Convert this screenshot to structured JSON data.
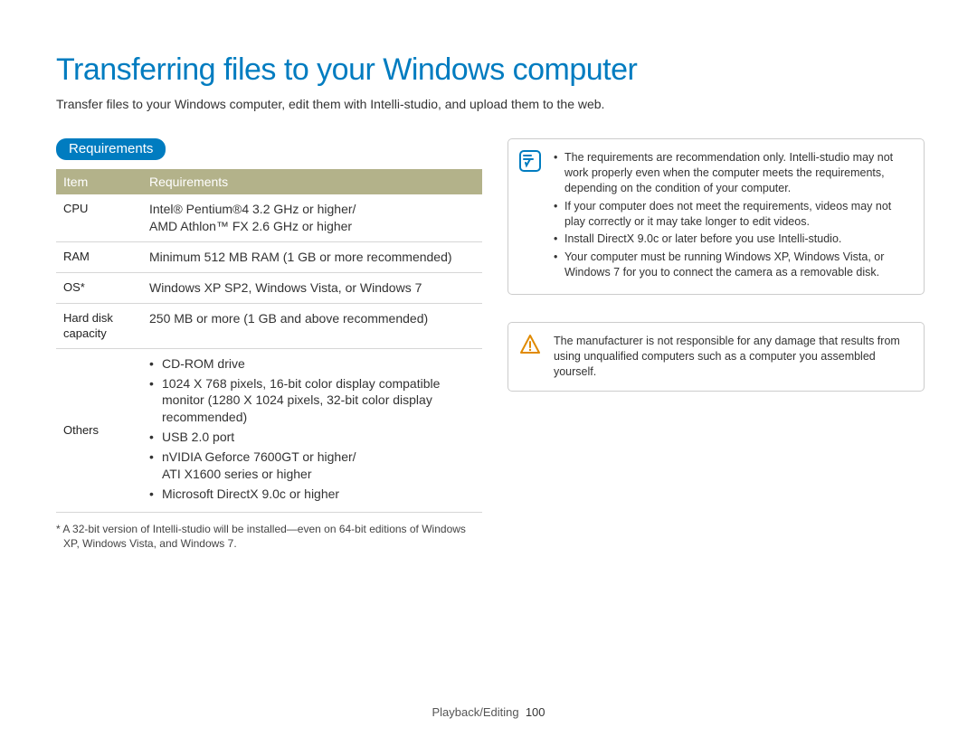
{
  "title": "Transferring files to your Windows computer",
  "intro": "Transfer files to your Windows computer, edit them with Intelli-studio, and upload them to the web.",
  "section_label": "Requirements",
  "table": {
    "head_item": "Item",
    "head_req": "Requirements",
    "rows": {
      "cpu_label": "CPU",
      "cpu_value": "Intel® Pentium®4 3.2 GHz or higher/\nAMD Athlon™ FX 2.6 GHz or higher",
      "ram_label": "RAM",
      "ram_value": "Minimum 512 MB RAM (1 GB or more recommended)",
      "os_label": "OS*",
      "os_value": "Windows XP SP2, Windows Vista, or Windows 7",
      "hdd_label": "Hard disk capacity",
      "hdd_value": "250 MB or more (1 GB and above recommended)",
      "others_label": "Others",
      "others_items": {
        "i1": "CD-ROM drive",
        "i2": "1024 X 768 pixels, 16-bit color display compatible monitor (1280 X 1024 pixels, 32-bit color display recommended)",
        "i3": "USB 2.0 port",
        "i4": "nVIDIA Geforce 7600GT or higher/\nATI X1600 series or higher",
        "i5": "Microsoft DirectX 9.0c or higher"
      }
    }
  },
  "footnote": "* A 32-bit version of Intelli-studio will be installed—even on 64-bit editions of Windows XP, Windows Vista, and Windows 7.",
  "notes": {
    "n1": "The requirements are recommendation only. Intelli-studio may not work properly even when the computer meets the requirements, depending on the condition of your computer.",
    "n2": "If your computer does not meet the requirements, videos may not play correctly or it may take longer to edit videos.",
    "n3": "Install DirectX 9.0c or later before you use Intelli-studio.",
    "n4": "Your computer must be running Windows XP, Windows Vista, or Windows 7 for you to connect the camera as a removable disk."
  },
  "warning": "The manufacturer is not responsible for any damage that results from using unqualified computers such as a computer you assembled yourself.",
  "footer": {
    "section": "Playback/Editing",
    "page": "100"
  }
}
